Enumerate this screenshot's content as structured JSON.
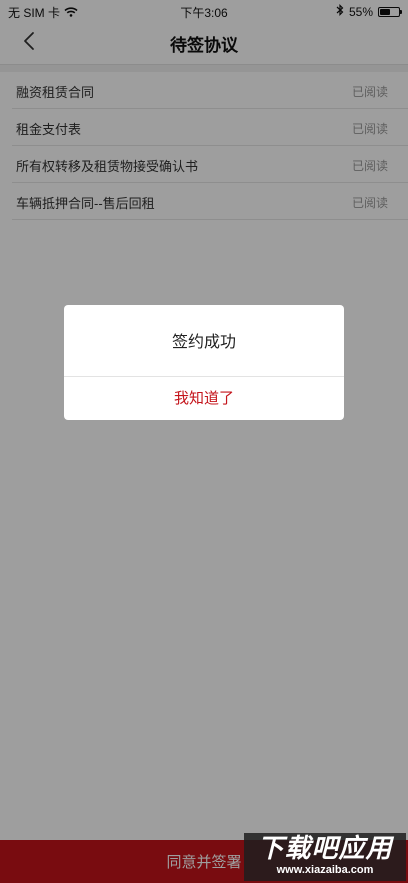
{
  "status_bar": {
    "carrier": "无 SIM 卡",
    "time": "下午3:06",
    "battery_percent": "55%",
    "battery_level": 0.55,
    "icons": [
      "wifi-icon",
      "bluetooth-icon",
      "battery-icon"
    ]
  },
  "nav": {
    "back_icon": "chevron-left-icon",
    "title": "待签协议"
  },
  "documents": [
    {
      "name": "融资租赁合同",
      "status": "已阅读"
    },
    {
      "name": "租金支付表",
      "status": "已阅读"
    },
    {
      "name": "所有权转移及租赁物接受确认书",
      "status": "已阅读"
    },
    {
      "name": "车辆抵押合同--售后回租",
      "status": "已阅读"
    }
  ],
  "footer": {
    "button_label": "同意并签署"
  },
  "dialog": {
    "message": "签约成功",
    "confirm_label": "我知道了"
  },
  "watermark": {
    "main": "下载吧应用",
    "url": "www.xiazaiba.com"
  },
  "colors": {
    "accent": "#c4141b",
    "overlay": "rgba(0,0,0,0.38)"
  }
}
